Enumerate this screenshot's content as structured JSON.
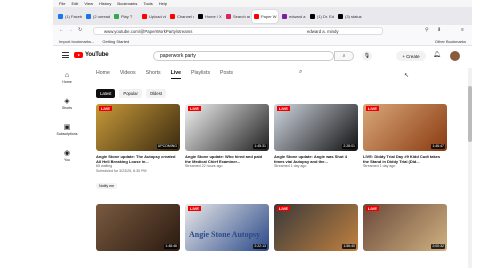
{
  "browser": {
    "menu": [
      "File",
      "Edit",
      "View",
      "History",
      "Bookmarks",
      "Tools",
      "Help"
    ],
    "tabs": [
      {
        "label": "(1) Faceboo",
        "color": "#1877f2",
        "active": false
      },
      {
        "label": "(2 unread)",
        "color": "#1a73e8",
        "active": false
      },
      {
        "label": "Play T",
        "color": "#34a853",
        "active": false
      },
      {
        "label": "Upload vid",
        "color": "#ff0000",
        "active": false
      },
      {
        "label": "Channel co",
        "color": "#ff0000",
        "active": false
      },
      {
        "label": "Home / X",
        "color": "#000000",
        "active": false
      },
      {
        "label": "Search and",
        "color": "#e0245e",
        "active": false
      },
      {
        "label": "Paper W",
        "color": "#ff0000",
        "active": true
      },
      {
        "label": "edward a",
        "color": "#7b1fa2",
        "active": false
      },
      {
        "label": "(1) Dr. Edw",
        "color": "#000000",
        "active": false
      },
      {
        "label": "(3) status",
        "color": "#000000",
        "active": false
      }
    ],
    "url": "www.youtube.com/@PaperWorkParty/streams",
    "url_search": "edward a. mindy",
    "bookmarks": [
      "Import bookmarks...",
      "Getting Started"
    ],
    "other_bookmarks": "Other Bookmarks"
  },
  "youtube": {
    "logo_text": "YouTube",
    "search_value": "paperwork party",
    "create_label": "Create",
    "sidebar": [
      {
        "icon": "home-icon",
        "glyph": "⌂",
        "label": "Home"
      },
      {
        "icon": "shorts-icon",
        "glyph": "◈",
        "label": "Shorts"
      },
      {
        "icon": "subscriptions-icon",
        "glyph": "▣",
        "label": "Subscriptions"
      },
      {
        "icon": "you-icon",
        "glyph": "◉",
        "label": "You"
      }
    ],
    "channel_tabs": [
      "Home",
      "Videos",
      "Shorts",
      "Live",
      "Playlists",
      "Posts"
    ],
    "active_tab": "Live",
    "chips": [
      "Latest",
      "Popular",
      "Oldest"
    ],
    "videos": [
      {
        "title": "Angie Stone update: The Autopsy created All Hell Breaking Loose in...",
        "meta1": "65 waiting",
        "meta2": "Scheduled for 3/23/25, 6:30 PM",
        "duration": "UPCOMING",
        "live": true,
        "notify": "Notify me",
        "bg": "#c89a3a",
        "accent": "#3a2a10"
      },
      {
        "title": "Angie Stone update: Who hired and paid the Medical Chief Examiner...",
        "meta1": "",
        "meta2": "Streamed 22 hours ago",
        "duration": "1:45:31",
        "live": true,
        "notify": "",
        "bg": "#f2f2f2",
        "accent": "#202020"
      },
      {
        "title": "Angie Stone update: Angie was Shot 4 times via/ Autopsy and the...",
        "meta1": "",
        "meta2": "Streamed 1 day ago",
        "duration": "2:28:01",
        "live": true,
        "notify": "",
        "bg": "#d0d6e0",
        "accent": "#111111"
      },
      {
        "title": "LIVE: Diddy Trial Day #9 Kidd Cudi takes the Stand in Diddy Trial (Did...",
        "meta1": "",
        "meta2": "Streamed 1 day ago",
        "duration": "1:46:47",
        "live": true,
        "notify": "",
        "bg": "#d9a87a",
        "accent": "#8a3a10"
      },
      {
        "title": "",
        "meta1": "",
        "meta2": "",
        "duration": "1:48:46",
        "live": false,
        "notify": "",
        "bg": "#7a5a40",
        "accent": "#2a1a10"
      },
      {
        "title": "Angie Stone Autopsy",
        "meta1": "",
        "meta2": "",
        "duration": "2:22:13",
        "live": true,
        "notify": "",
        "bg": "#e8e8e8",
        "accent": "#2b4a8a"
      },
      {
        "title": "",
        "meta1": "",
        "meta2": "",
        "duration": "1:56:40",
        "live": true,
        "notify": "",
        "bg": "#3a3a3a",
        "accent": "#c08040"
      },
      {
        "title": "",
        "meta1": "",
        "meta2": "",
        "duration": "2:00:32",
        "live": true,
        "notify": "",
        "bg": "#6a4a3a",
        "accent": "#d0b080"
      }
    ]
  },
  "labels": {
    "live": "LIVE",
    "upcoming_text": "UPCOMING"
  },
  "colors": {
    "yt_red": "#ff0000",
    "live_badge": "#e00000"
  }
}
